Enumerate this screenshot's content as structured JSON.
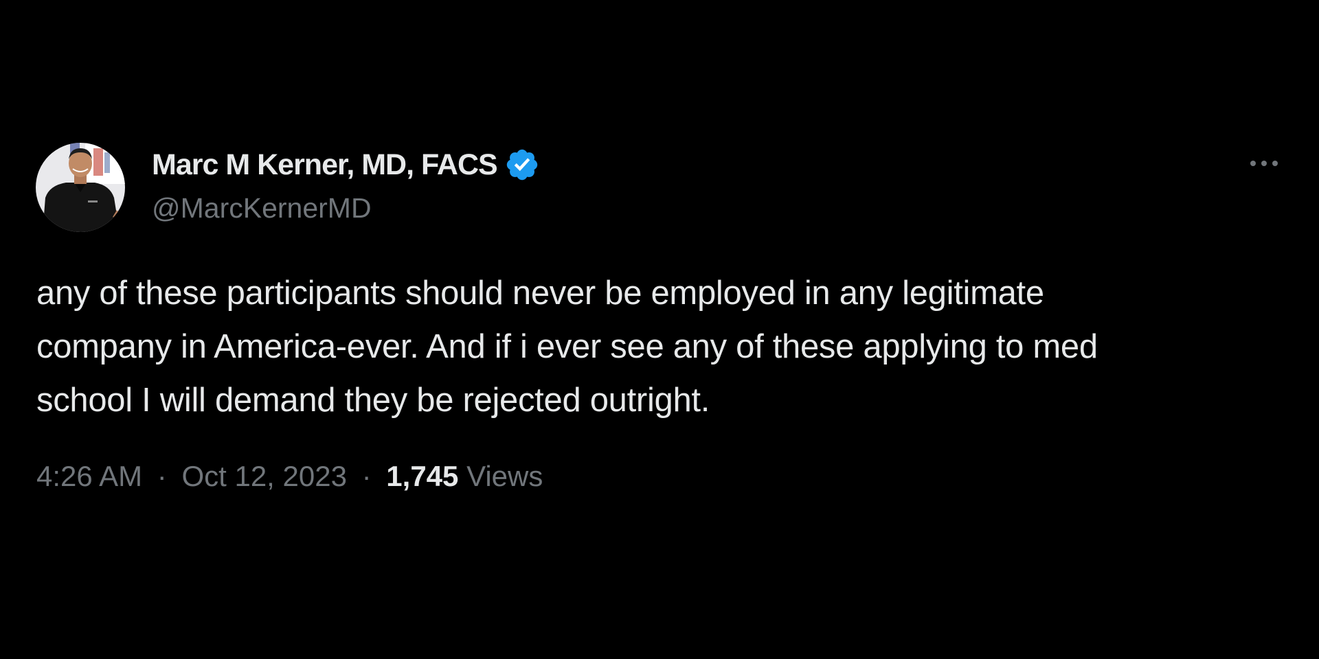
{
  "author": {
    "display_name": "Marc M Kerner, MD, FACS",
    "handle": "@MarcKernerMD",
    "verified": true,
    "avatar_icon": "profile-photo"
  },
  "tweet": {
    "text_lines": [
      "any of these participants should never be employed in any legitimate",
      "company in America-ever. And if i ever see any of these applying to med",
      "school I will demand they be rejected outright."
    ],
    "time": "4:26 AM",
    "separator": "·",
    "date": "Oct 12, 2023",
    "views_count": "1,745",
    "views_label": "Views"
  },
  "more_button_icon": "more-options-icon",
  "colors": {
    "background": "#000000",
    "primary_text": "#e7e9ea",
    "secondary_text": "#71767b",
    "verified_blue": "#1d9bf0"
  }
}
